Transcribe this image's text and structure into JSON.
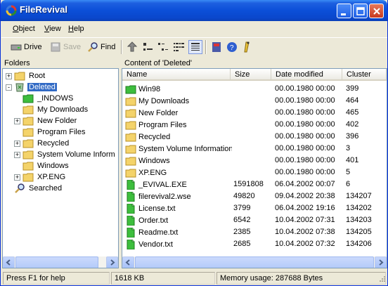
{
  "window": {
    "title": "FileRevival"
  },
  "menu": [
    "Object",
    "View",
    "Help"
  ],
  "toolbar": {
    "drive": "Drive",
    "save": "Save",
    "find": "Find"
  },
  "panes": {
    "folders_label": "Folders",
    "content_label": "Content of 'Deleted'"
  },
  "tree": [
    {
      "label": "Root",
      "level": 0,
      "expander": "+",
      "selected": false,
      "icon": "folder-icon"
    },
    {
      "label": "Deleted",
      "level": 0,
      "expander": "-",
      "selected": true,
      "icon": "recycle-bin-icon"
    },
    {
      "label": "_INDOWS",
      "level": 1,
      "expander": "",
      "selected": false,
      "icon": "green-folder-icon"
    },
    {
      "label": "My Downloads",
      "level": 1,
      "expander": "",
      "selected": false,
      "icon": "folder-icon"
    },
    {
      "label": "New Folder",
      "level": 1,
      "expander": "+",
      "selected": false,
      "icon": "folder-icon"
    },
    {
      "label": "Program Files",
      "level": 1,
      "expander": "",
      "selected": false,
      "icon": "folder-icon"
    },
    {
      "label": "Recycled",
      "level": 1,
      "expander": "+",
      "selected": false,
      "icon": "folder-icon"
    },
    {
      "label": "System Volume Inform",
      "level": 1,
      "expander": "+",
      "selected": false,
      "icon": "folder-icon"
    },
    {
      "label": "Windows",
      "level": 1,
      "expander": "",
      "selected": false,
      "icon": "folder-icon"
    },
    {
      "label": "XP.ENG",
      "level": 1,
      "expander": "+",
      "selected": false,
      "icon": "folder-icon"
    },
    {
      "label": "Searched",
      "level": 0,
      "expander": "",
      "selected": false,
      "icon": "search-icon"
    }
  ],
  "columns": [
    "Name",
    "Size",
    "Date modified",
    "Cluster"
  ],
  "files": [
    {
      "name": "Win98",
      "size": "",
      "date": "00.00.1980 00:00",
      "cluster": "399",
      "icon": "green-folder-icon"
    },
    {
      "name": "My Downloads",
      "size": "",
      "date": "00.00.1980 00:00",
      "cluster": "464",
      "icon": "folder-icon"
    },
    {
      "name": "New Folder",
      "size": "",
      "date": "00.00.1980 00:00",
      "cluster": "465",
      "icon": "folder-icon"
    },
    {
      "name": "Program Files",
      "size": "",
      "date": "00.00.1980 00:00",
      "cluster": "402",
      "icon": "folder-icon"
    },
    {
      "name": "Recycled",
      "size": "",
      "date": "00.00.1980 00:00",
      "cluster": "396",
      "icon": "folder-icon"
    },
    {
      "name": "System Volume Information",
      "size": "",
      "date": "00.00.1980 00:00",
      "cluster": "3",
      "icon": "folder-icon"
    },
    {
      "name": "Windows",
      "size": "",
      "date": "00.00.1980 00:00",
      "cluster": "401",
      "icon": "folder-icon"
    },
    {
      "name": "XP.ENG",
      "size": "",
      "date": "00.00.1980 00:00",
      "cluster": "5",
      "icon": "folder-icon"
    },
    {
      "name": "_EVIVAL.EXE",
      "size": "1591808",
      "date": "06.04.2002 00:07",
      "cluster": "6",
      "icon": "file-icon"
    },
    {
      "name": "filerevival2.wse",
      "size": "49820",
      "date": "09.04.2002 20:38",
      "cluster": "134207",
      "icon": "file-icon"
    },
    {
      "name": "License.txt",
      "size": "3799",
      "date": "06.04.2002 19:16",
      "cluster": "134202",
      "icon": "file-icon"
    },
    {
      "name": "Order.txt",
      "size": "6542",
      "date": "10.04.2002 07:31",
      "cluster": "134203",
      "icon": "file-icon"
    },
    {
      "name": "Readme.txt",
      "size": "2385",
      "date": "10.04.2002 07:38",
      "cluster": "134205",
      "icon": "file-icon"
    },
    {
      "name": "Vendor.txt",
      "size": "2685",
      "date": "10.04.2002 07:32",
      "cluster": "134206",
      "icon": "file-icon"
    }
  ],
  "status": {
    "help": "Press F1 for help",
    "size": "1618 KB",
    "memory": "Memory usage: 287688 Bytes"
  },
  "colors": {
    "titlebar": "#0A47CC",
    "selection": "#316AC5",
    "folder": "#F4D36A",
    "green_folder": "#3DBE3D"
  }
}
